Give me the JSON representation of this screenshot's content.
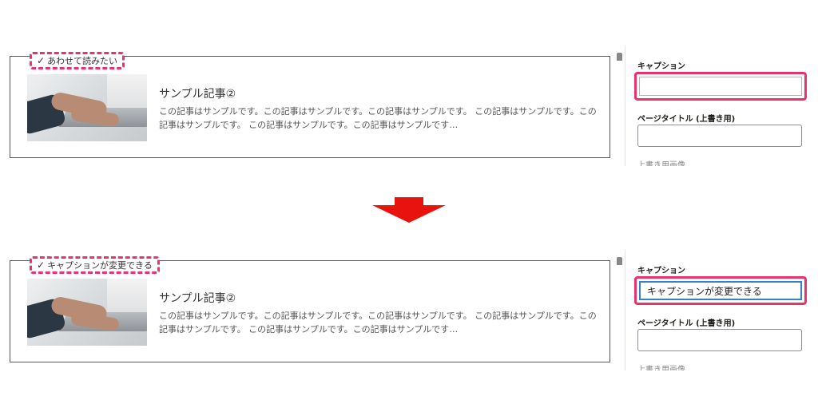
{
  "before": {
    "caption_label": "あわせて読みたい",
    "card_title": "サンプル記事②",
    "excerpt": "この記事はサンプルです。この記事はサンプルです。この記事はサンプルです。 この記事はサンプルです。この記事はサンプルです。 この記事はサンプルです。この記事はサンプルです…",
    "sidebar": {
      "caption_field_label": "キャプション",
      "caption_value": "",
      "page_title_label": "ページタイトル (上書き用)",
      "page_title_value": "",
      "truncated_label": "上書き用画像"
    }
  },
  "after": {
    "caption_label": "キャプションが変更できる",
    "card_title": "サンプル記事②",
    "excerpt": "この記事はサンプルです。この記事はサンプルです。この記事はサンプルです。 この記事はサンプルです。この記事はサンプルです。 この記事はサンプルです。この記事はサンプルです…",
    "sidebar": {
      "caption_field_label": "キャプション",
      "caption_value": "キャプションが変更できる",
      "page_title_label": "ページタイトル (上書き用)",
      "page_title_value": "",
      "truncated_label": "上書き用画像"
    }
  },
  "icons": {
    "check": "check-icon",
    "arrow": "down-arrow-icon"
  },
  "colors": {
    "highlight": "#e8336d",
    "arrow": "#e8130c",
    "focus": "#3582c4"
  }
}
